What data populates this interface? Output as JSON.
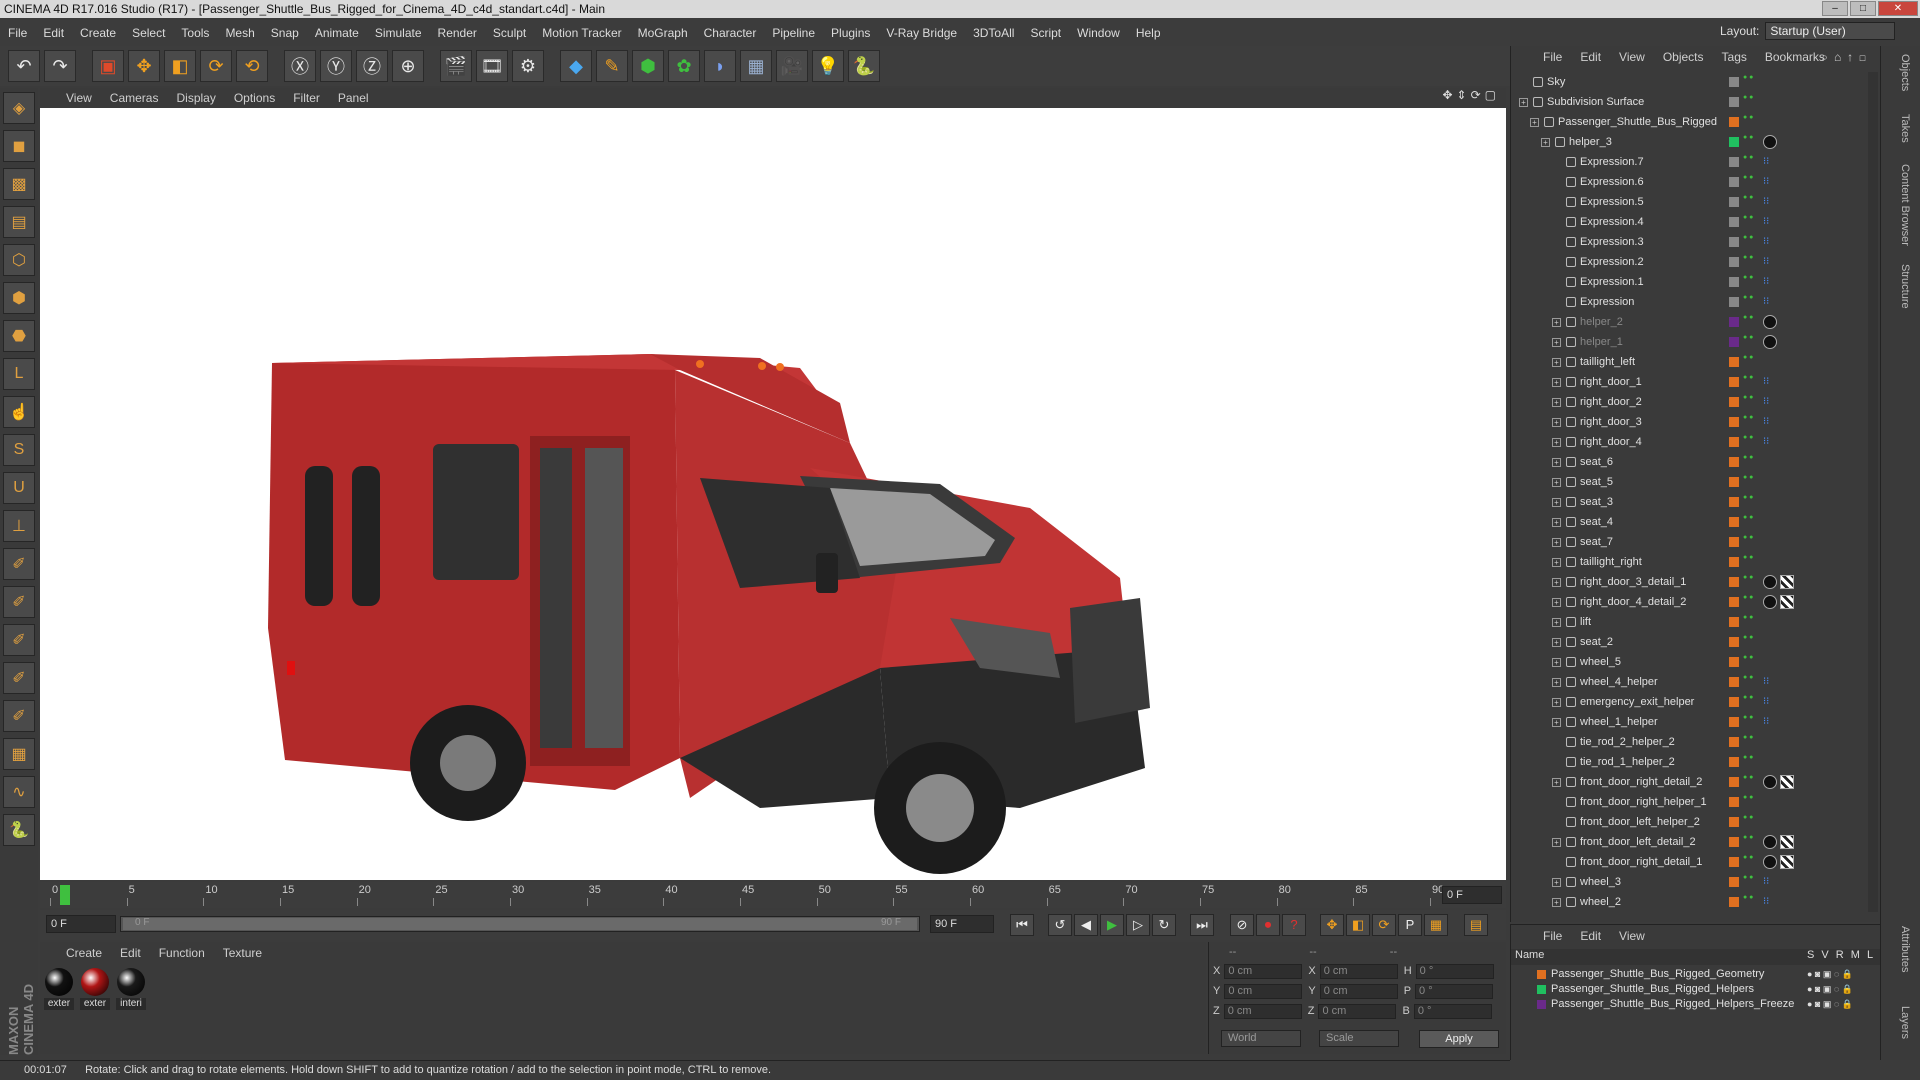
{
  "window": {
    "title": "CINEMA 4D R17.016 Studio (R17) - [Passenger_Shuttle_Bus_Rigged_for_Cinema_4D_c4d_standart.c4d] - Main"
  },
  "menu": [
    "File",
    "Edit",
    "Create",
    "Select",
    "Tools",
    "Mesh",
    "Snap",
    "Animate",
    "Simulate",
    "Render",
    "Sculpt",
    "Motion Tracker",
    "MoGraph",
    "Character",
    "Pipeline",
    "Plugins",
    "V-Ray Bridge",
    "3DToAll",
    "Script",
    "Window",
    "Help"
  ],
  "layout": {
    "label": "Layout:",
    "value": "Startup (User)"
  },
  "viewport_menu": [
    "View",
    "Cameras",
    "Display",
    "Options",
    "Filter",
    "Panel"
  ],
  "timeline": {
    "ticks": [
      "0",
      "5",
      "10",
      "15",
      "20",
      "25",
      "30",
      "35",
      "40",
      "45",
      "50",
      "55",
      "60",
      "65",
      "70",
      "75",
      "80",
      "85",
      "90"
    ],
    "current_frame": "0 F"
  },
  "transport": {
    "start": "0 F",
    "slider_start": "0 F",
    "slider_end": "90 F",
    "end": "90 F"
  },
  "material_menu": [
    "Create",
    "Edit",
    "Function",
    "Texture"
  ],
  "materials": [
    {
      "label": "exter",
      "color": "#111111"
    },
    {
      "label": "exter",
      "color": "#b01515"
    },
    {
      "label": "interi",
      "color": "#1a1a1a"
    }
  ],
  "coords": {
    "header": [
      "--",
      "--",
      "--"
    ],
    "rows": [
      {
        "a": "X",
        "av": "0 cm",
        "b": "X",
        "bv": "0 cm",
        "c": "H",
        "cv": "0 °"
      },
      {
        "a": "Y",
        "av": "0 cm",
        "b": "Y",
        "bv": "0 cm",
        "c": "P",
        "cv": "0 °"
      },
      {
        "a": "Z",
        "av": "0 cm",
        "b": "Z",
        "bv": "0 cm",
        "c": "B",
        "cv": "0 °"
      }
    ],
    "space": "World",
    "mode": "Scale",
    "apply": "Apply"
  },
  "status": {
    "time": "00:01:07",
    "message": "Rotate: Click and drag to rotate elements. Hold down SHIFT to add to quantize rotation / add to the selection in point mode, CTRL to remove."
  },
  "objects_menu": [
    "File",
    "Edit",
    "View",
    "Objects",
    "Tags",
    "Bookmarks"
  ],
  "objects": [
    {
      "name": "Sky",
      "indent": 0,
      "expand": false,
      "color": "#888888",
      "tags": "",
      "grey": false
    },
    {
      "name": "Subdivision Surface",
      "indent": 0,
      "expand": true,
      "color": "#888888",
      "tags": "",
      "grey": false
    },
    {
      "name": "Passenger_Shuttle_Bus_Rigged",
      "indent": 1,
      "expand": true,
      "color": "#e07020",
      "tags": "",
      "grey": false
    },
    {
      "name": "helper_3",
      "indent": 2,
      "expand": true,
      "color": "#20c060",
      "tags": "ball",
      "grey": false
    },
    {
      "name": "Expression.7",
      "indent": 3,
      "expand": false,
      "color": "#888888",
      "tags": "dots",
      "grey": false
    },
    {
      "name": "Expression.6",
      "indent": 3,
      "expand": false,
      "color": "#888888",
      "tags": "dots",
      "grey": false
    },
    {
      "name": "Expression.5",
      "indent": 3,
      "expand": false,
      "color": "#888888",
      "tags": "dots",
      "grey": false
    },
    {
      "name": "Expression.4",
      "indent": 3,
      "expand": false,
      "color": "#888888",
      "tags": "dots",
      "grey": false
    },
    {
      "name": "Expression.3",
      "indent": 3,
      "expand": false,
      "color": "#888888",
      "tags": "dots",
      "grey": false
    },
    {
      "name": "Expression.2",
      "indent": 3,
      "expand": false,
      "color": "#888888",
      "tags": "dots",
      "grey": false
    },
    {
      "name": "Expression.1",
      "indent": 3,
      "expand": false,
      "color": "#888888",
      "tags": "dots",
      "grey": false
    },
    {
      "name": "Expression",
      "indent": 3,
      "expand": false,
      "color": "#888888",
      "tags": "dots",
      "grey": false
    },
    {
      "name": "helper_2",
      "indent": 3,
      "expand": true,
      "color": "#6a2a8a",
      "tags": "ball",
      "grey": true
    },
    {
      "name": "helper_1",
      "indent": 3,
      "expand": true,
      "color": "#6a2a8a",
      "tags": "ball",
      "grey": true
    },
    {
      "name": "taillight_left",
      "indent": 3,
      "expand": true,
      "color": "#e07020",
      "tags": "",
      "grey": false
    },
    {
      "name": "right_door_1",
      "indent": 3,
      "expand": true,
      "color": "#e07020",
      "tags": "dots",
      "grey": false
    },
    {
      "name": "right_door_2",
      "indent": 3,
      "expand": true,
      "color": "#e07020",
      "tags": "dots",
      "grey": false
    },
    {
      "name": "right_door_3",
      "indent": 3,
      "expand": true,
      "color": "#e07020",
      "tags": "dots",
      "grey": false
    },
    {
      "name": "right_door_4",
      "indent": 3,
      "expand": true,
      "color": "#e07020",
      "tags": "dots",
      "grey": false
    },
    {
      "name": "seat_6",
      "indent": 3,
      "expand": true,
      "color": "#e07020",
      "tags": "",
      "grey": false
    },
    {
      "name": "seat_5",
      "indent": 3,
      "expand": true,
      "color": "#e07020",
      "tags": "",
      "grey": false
    },
    {
      "name": "seat_3",
      "indent": 3,
      "expand": true,
      "color": "#e07020",
      "tags": "",
      "grey": false
    },
    {
      "name": "seat_4",
      "indent": 3,
      "expand": true,
      "color": "#e07020",
      "tags": "",
      "grey": false
    },
    {
      "name": "seat_7",
      "indent": 3,
      "expand": true,
      "color": "#e07020",
      "tags": "",
      "grey": false
    },
    {
      "name": "taillight_right",
      "indent": 3,
      "expand": true,
      "color": "#e07020",
      "tags": "",
      "grey": false
    },
    {
      "name": "right_door_3_detail_1",
      "indent": 3,
      "expand": true,
      "color": "#e07020",
      "tags": "ballchk",
      "grey": false
    },
    {
      "name": "right_door_4_detail_2",
      "indent": 3,
      "expand": true,
      "color": "#e07020",
      "tags": "ballchk",
      "grey": false
    },
    {
      "name": "lift",
      "indent": 3,
      "expand": true,
      "color": "#e07020",
      "tags": "",
      "grey": false
    },
    {
      "name": "seat_2",
      "indent": 3,
      "expand": true,
      "color": "#e07020",
      "tags": "",
      "grey": false
    },
    {
      "name": "wheel_5",
      "indent": 3,
      "expand": true,
      "color": "#e07020",
      "tags": "",
      "grey": false
    },
    {
      "name": "wheel_4_helper",
      "indent": 3,
      "expand": true,
      "color": "#e07020",
      "tags": "dots",
      "grey": false
    },
    {
      "name": "emergency_exit_helper",
      "indent": 3,
      "expand": true,
      "color": "#e07020",
      "tags": "dots",
      "grey": false
    },
    {
      "name": "wheel_1_helper",
      "indent": 3,
      "expand": true,
      "color": "#e07020",
      "tags": "dots",
      "grey": false
    },
    {
      "name": "tie_rod_2_helper_2",
      "indent": 3,
      "expand": false,
      "color": "#e07020",
      "tags": "",
      "grey": false
    },
    {
      "name": "tie_rod_1_helper_2",
      "indent": 3,
      "expand": false,
      "color": "#e07020",
      "tags": "",
      "grey": false
    },
    {
      "name": "front_door_right_detail_2",
      "indent": 3,
      "expand": true,
      "color": "#e07020",
      "tags": "ballchk",
      "grey": false
    },
    {
      "name": "front_door_right_helper_1",
      "indent": 3,
      "expand": false,
      "color": "#e07020",
      "tags": "",
      "grey": false
    },
    {
      "name": "front_door_left_helper_2",
      "indent": 3,
      "expand": false,
      "color": "#e07020",
      "tags": "",
      "grey": false
    },
    {
      "name": "front_door_left_detail_2",
      "indent": 3,
      "expand": true,
      "color": "#e07020",
      "tags": "ballchk",
      "grey": false
    },
    {
      "name": "front_door_right_detail_1",
      "indent": 3,
      "expand": false,
      "color": "#e07020",
      "tags": "ballchk",
      "grey": false
    },
    {
      "name": "wheel_3",
      "indent": 3,
      "expand": true,
      "color": "#e07020",
      "tags": "dots",
      "grey": false
    },
    {
      "name": "wheel_2",
      "indent": 3,
      "expand": true,
      "color": "#e07020",
      "tags": "dots",
      "grey": false
    }
  ],
  "layers_menu": [
    "File",
    "Edit",
    "View"
  ],
  "layers_head": {
    "name": "Name",
    "cols": "S V R M L"
  },
  "layers": [
    {
      "name": "Passenger_Shuttle_Bus_Rigged_Geometry",
      "color": "#e07020"
    },
    {
      "name": "Passenger_Shuttle_Bus_Rigged_Helpers",
      "color": "#20c060"
    },
    {
      "name": "Passenger_Shuttle_Bus_Rigged_Helpers_Freeze",
      "color": "#6a2a8a"
    }
  ],
  "side_tabs": [
    "Objects",
    "Takes",
    "Content Browser",
    "Structure"
  ],
  "side_tabs_lower": [
    "Attributes",
    "Layers"
  ]
}
